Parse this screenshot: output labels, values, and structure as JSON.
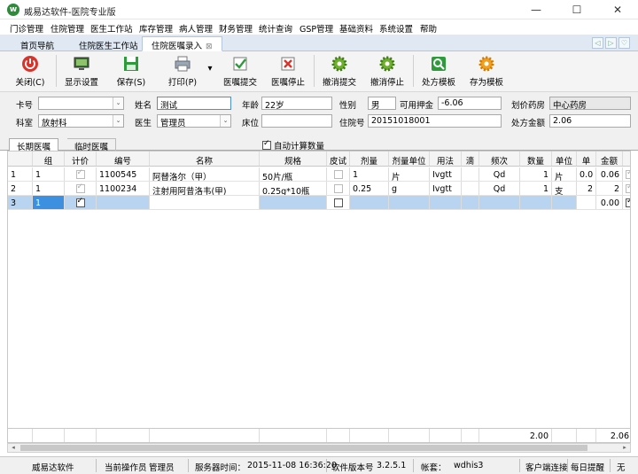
{
  "app": {
    "title": "威易达软件-医院专业版",
    "logo_letter": "w",
    "controls": {
      "minimize": "—",
      "maximize": "☐",
      "close": "✕"
    }
  },
  "menu": [
    "门诊管理",
    "住院管理",
    "医生工作站",
    "库存管理",
    "病人管理",
    "财务管理",
    "统计查询",
    "GSP管理",
    "基础资料",
    "系统设置",
    "帮助"
  ],
  "tabs": [
    {
      "label": "首页导航"
    },
    {
      "label": "住院医生工作站"
    },
    {
      "label": "住院医嘱录入",
      "close": "⊠"
    }
  ],
  "tab_nav": [
    "◁",
    "▷",
    "♡"
  ],
  "toolbar": [
    {
      "label": "关闭(C)",
      "icon": "power-icon"
    },
    {
      "label": "显示设置",
      "icon": "monitor-icon"
    },
    {
      "label": "保存(S)",
      "icon": "save-icon"
    },
    {
      "label": "打印(P)",
      "icon": "printer-icon",
      "dropdown": "▾"
    },
    {
      "label": "医嘱提交",
      "icon": "check-icon"
    },
    {
      "label": "医嘱停止",
      "icon": "stop-icon"
    },
    {
      "label": "撤消提交",
      "icon": "gear-icon"
    },
    {
      "label": "撤消停止",
      "icon": "gear-icon"
    },
    {
      "label": "处方模板",
      "icon": "search-icon"
    },
    {
      "label": "存为模板",
      "icon": "gear-orange-icon"
    }
  ],
  "form": {
    "card_no": {
      "label": "卡号",
      "value": ""
    },
    "name": {
      "label": "姓名",
      "value": "测试"
    },
    "age": {
      "label": "年龄",
      "value": "22岁"
    },
    "gender": {
      "label": "性别",
      "value": "男"
    },
    "deposit": {
      "label": "可用押金",
      "value": "-6.06"
    },
    "pharmacy": {
      "label": "划价药房",
      "value": "中心药房"
    },
    "dept": {
      "label": "科室",
      "value": "放射科"
    },
    "doctor": {
      "label": "医生",
      "value": "管理员"
    },
    "bed": {
      "label": "床位",
      "value": ""
    },
    "inpatient_no": {
      "label": "住院号",
      "value": "20151018001"
    },
    "rx_amount": {
      "label": "处方金额",
      "value": "2.06"
    },
    "dropdown_glyph": "⌄"
  },
  "subtabs": {
    "long_term": "长期医嘱",
    "temporary": "临时医嘱",
    "auto_calc_label": "自动计算数量"
  },
  "grid": {
    "columns": [
      "",
      "组",
      "计价",
      "编号",
      "名称",
      "规格",
      "皮试",
      "剂量",
      "剂量单位",
      "用法",
      "滴",
      "频次",
      "数量",
      "单位",
      "单",
      "金额",
      ""
    ],
    "rows": [
      {
        "idx": "1",
        "group": "1",
        "code": "1100545",
        "name": "阿替洛尔（甲）",
        "spec": "50片/瓶",
        "dose": "1",
        "dose_unit": "片",
        "usage": "Ivgtt",
        "drip": "",
        "freq": "Qd",
        "qty": "1",
        "unit": "片",
        "price": "0.0",
        "amount": "0.06"
      },
      {
        "idx": "2",
        "group": "1",
        "code": "1100234",
        "name": "注射用阿昔洛韦(甲)",
        "spec": "0.25g*10瓶",
        "dose": "0.25",
        "dose_unit": "g",
        "usage": "Ivgtt",
        "drip": "",
        "freq": "Qd",
        "qty": "1",
        "unit": "支",
        "price": "2",
        "amount": "2"
      },
      {
        "idx": "3",
        "group": "1",
        "code": "",
        "name": "",
        "spec": "",
        "dose": "",
        "dose_unit": "",
        "usage": "",
        "drip": "",
        "freq": "",
        "qty": "",
        "unit": "",
        "price": "",
        "amount": "0.00"
      }
    ],
    "sum_qty": "2.00",
    "sum_amount": "2.06"
  },
  "scroll": {
    "left": "◂",
    "right": "▸"
  },
  "status": {
    "company": "威易达软件",
    "operator_label": "当前操作员",
    "operator": "管理员",
    "server_time_label": "服务器时间：",
    "server_time": "2015-11-08 16:36:20",
    "version_label": "软件版本号",
    "version": "3.2.5.1",
    "account_label": "帐套：",
    "account": "wdhis3",
    "client_status": "客户端连接",
    "daily_tip": "每日提醒",
    "extra": "无"
  }
}
